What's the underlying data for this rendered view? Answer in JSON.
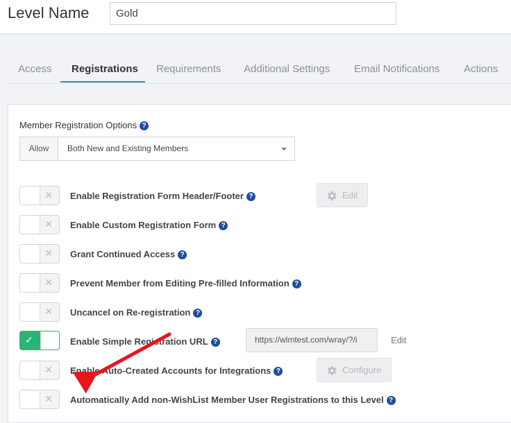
{
  "header": {
    "level_label": "Level Name",
    "level_value": "Gold"
  },
  "tabs": [
    {
      "label": "Access"
    },
    {
      "label": "Registrations"
    },
    {
      "label": "Requirements"
    },
    {
      "label": "Additional Settings"
    },
    {
      "label": "Email Notifications"
    },
    {
      "label": "Actions"
    }
  ],
  "member_options": {
    "title": "Member Registration Options",
    "allow_label": "Allow",
    "allow_value": "Both New and Existing Members"
  },
  "help_glyph": "?",
  "toggle_glyphs": {
    "off": "✕",
    "on": "✓"
  },
  "rows": [
    {
      "label": "Enable Registration Form Header/Footer",
      "enabled": false
    },
    {
      "label": "Enable Custom Registration Form",
      "enabled": false
    },
    {
      "label": "Grant Continued Access",
      "enabled": false
    },
    {
      "label": "Prevent Member from Editing Pre-filled Information",
      "enabled": false
    },
    {
      "label": "Uncancel on Re-registration",
      "enabled": false
    },
    {
      "label": "Enable Simple Registration URL",
      "enabled": true
    },
    {
      "label": "Enable Auto-Created Accounts for Integrations",
      "enabled": false
    },
    {
      "label": "Automatically Add non-WishList Member User Registrations to this Level",
      "enabled": false
    }
  ],
  "buttons": {
    "edit": "Edit",
    "configure": "Configure"
  },
  "simple_url": {
    "value": "https://wlmtest.com/wray/?/i",
    "edit_label": "Edit"
  },
  "colors": {
    "accent": "#2f86c6",
    "toggle_on": "#29b573",
    "help_icon": "#1b4f9c",
    "arrow": "#e8151b"
  }
}
